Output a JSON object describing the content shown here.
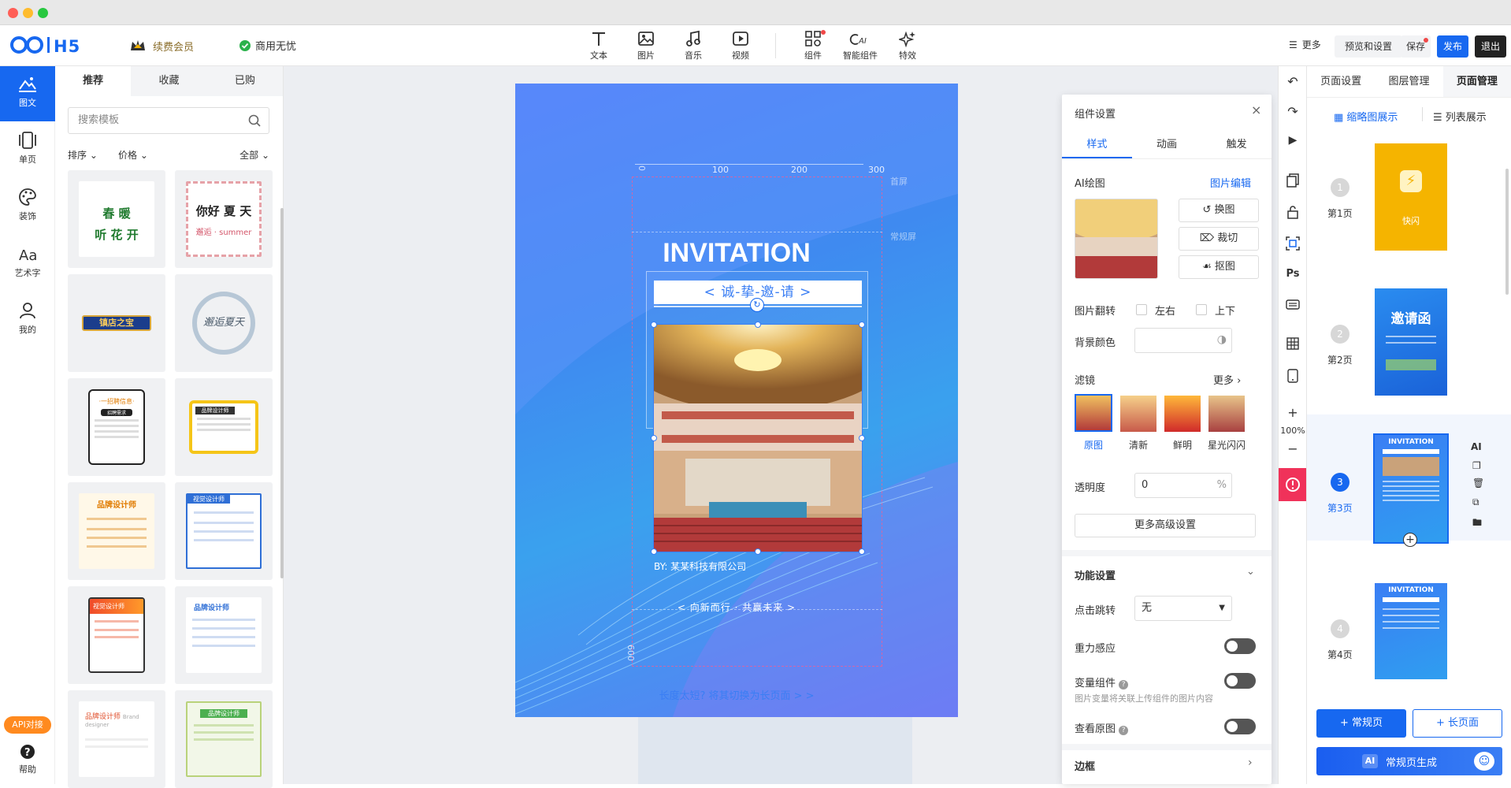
{
  "app": {
    "logo_text": "●●|H5",
    "vip_label": "续费会员",
    "free_label": "商用无忧"
  },
  "toolbar": {
    "items": [
      {
        "label": "文本"
      },
      {
        "label": "图片"
      },
      {
        "label": "音乐"
      },
      {
        "label": "视频"
      },
      {
        "label": "组件"
      },
      {
        "label": "智能组件"
      },
      {
        "label": "特效"
      }
    ],
    "more_label": "更多",
    "preview_label": "预览和设置",
    "save_label": "保存",
    "publish_label": "发布",
    "exit_label": "退出"
  },
  "leftnav": {
    "items": [
      {
        "label": "图文"
      },
      {
        "label": "单页"
      },
      {
        "label": "装饰"
      },
      {
        "label": "艺术字"
      },
      {
        "label": "我的"
      }
    ],
    "api_label": "API对接",
    "help_label": "帮助"
  },
  "templates": {
    "tabs": [
      "推荐",
      "收藏",
      "已购"
    ],
    "search_placeholder": "搜索模板",
    "sort_label": "排序",
    "price_label": "价格",
    "all_label": "全部",
    "items": [
      {
        "line1": "春 暖",
        "line2": "听 花 开"
      },
      {
        "line1": "你好 夏 天",
        "line2": "邂逅 · summer"
      },
      {
        "line1": "镇店之宝"
      },
      {
        "line1": "邂逅夏天"
      },
      {
        "line1": "·一招聘信息·",
        "line2": "招聘需求"
      },
      {
        "line1": "品牌设计师"
      },
      {
        "line1": "品牌设计师"
      },
      {
        "line1": "视觉设计师"
      },
      {
        "line1": "视觉设计师"
      },
      {
        "line1": "品牌设计师"
      },
      {
        "line1": "品牌设计师",
        "line2": "Brand designer"
      },
      {
        "line1": "品牌设计师"
      }
    ]
  },
  "canvas": {
    "title": "INVITATION",
    "subtitle": "< 诚-挚-邀-请 >",
    "by_text": "BY: 某某科技有限公司",
    "footer_text": "< 向新而行 · 共赢未来 >",
    "hint": "长度太短? 将其切换为长页面 > >",
    "first_screen": "首屏",
    "normal_screen": "常规屏",
    "ruler": [
      "0",
      "100",
      "200",
      "300"
    ],
    "ruler_v": "600",
    "ai_badge": "AI"
  },
  "settings": {
    "title": "组件设置",
    "tabs": [
      "样式",
      "动画",
      "触发"
    ],
    "ai_draw": "AI绘图",
    "img_edit": "图片编辑",
    "btn_replace": "换图",
    "btn_crop": "裁切",
    "btn_cutout": "抠图",
    "flip_label": "图片翻转",
    "flip_lr": "左右",
    "flip_ud": "上下",
    "bg_label": "背景颜色",
    "filter_label": "滤镜",
    "filter_more": "更多",
    "filters": [
      "原图",
      "清新",
      "鲜明",
      "星光闪闪"
    ],
    "opacity_label": "透明度",
    "opacity_value": "0",
    "opacity_unit": "%",
    "advanced": "更多高级设置",
    "func_title": "功能设置",
    "jump_label": "点击跳转",
    "jump_value": "无",
    "gravity": "重力感应",
    "var_comp": "变量组件",
    "var_hint": "图片变量将关联上传组件的图片内容",
    "view_orig": "查看原图",
    "border_title": "边框"
  },
  "righttools": {
    "zoom": "100%",
    "ps": "Ps",
    "plus": "+",
    "minus": "−"
  },
  "pages": {
    "tabs": [
      "页面设置",
      "图层管理",
      "页面管理"
    ],
    "view_thumb": "缩略图展示",
    "view_list": "列表展示",
    "items": [
      {
        "num": "1",
        "label": "第1页",
        "thumb_text": "快闪"
      },
      {
        "num": "2",
        "label": "第2页",
        "thumb_text": "邀请函"
      },
      {
        "num": "3",
        "label": "第3页",
        "thumb_text": "INVITATION"
      },
      {
        "num": "4",
        "label": "第4页",
        "thumb_text": "INVITATION"
      }
    ],
    "add_normal": "+ 常规页",
    "add_long": "+ 长页面",
    "ai_gen": "常规页生成",
    "ai_badge": "AI",
    "side_ai": "AI"
  },
  "colors": {
    "accent": "#1768f0",
    "danger": "#f0325a",
    "gold": "#f5b400"
  }
}
